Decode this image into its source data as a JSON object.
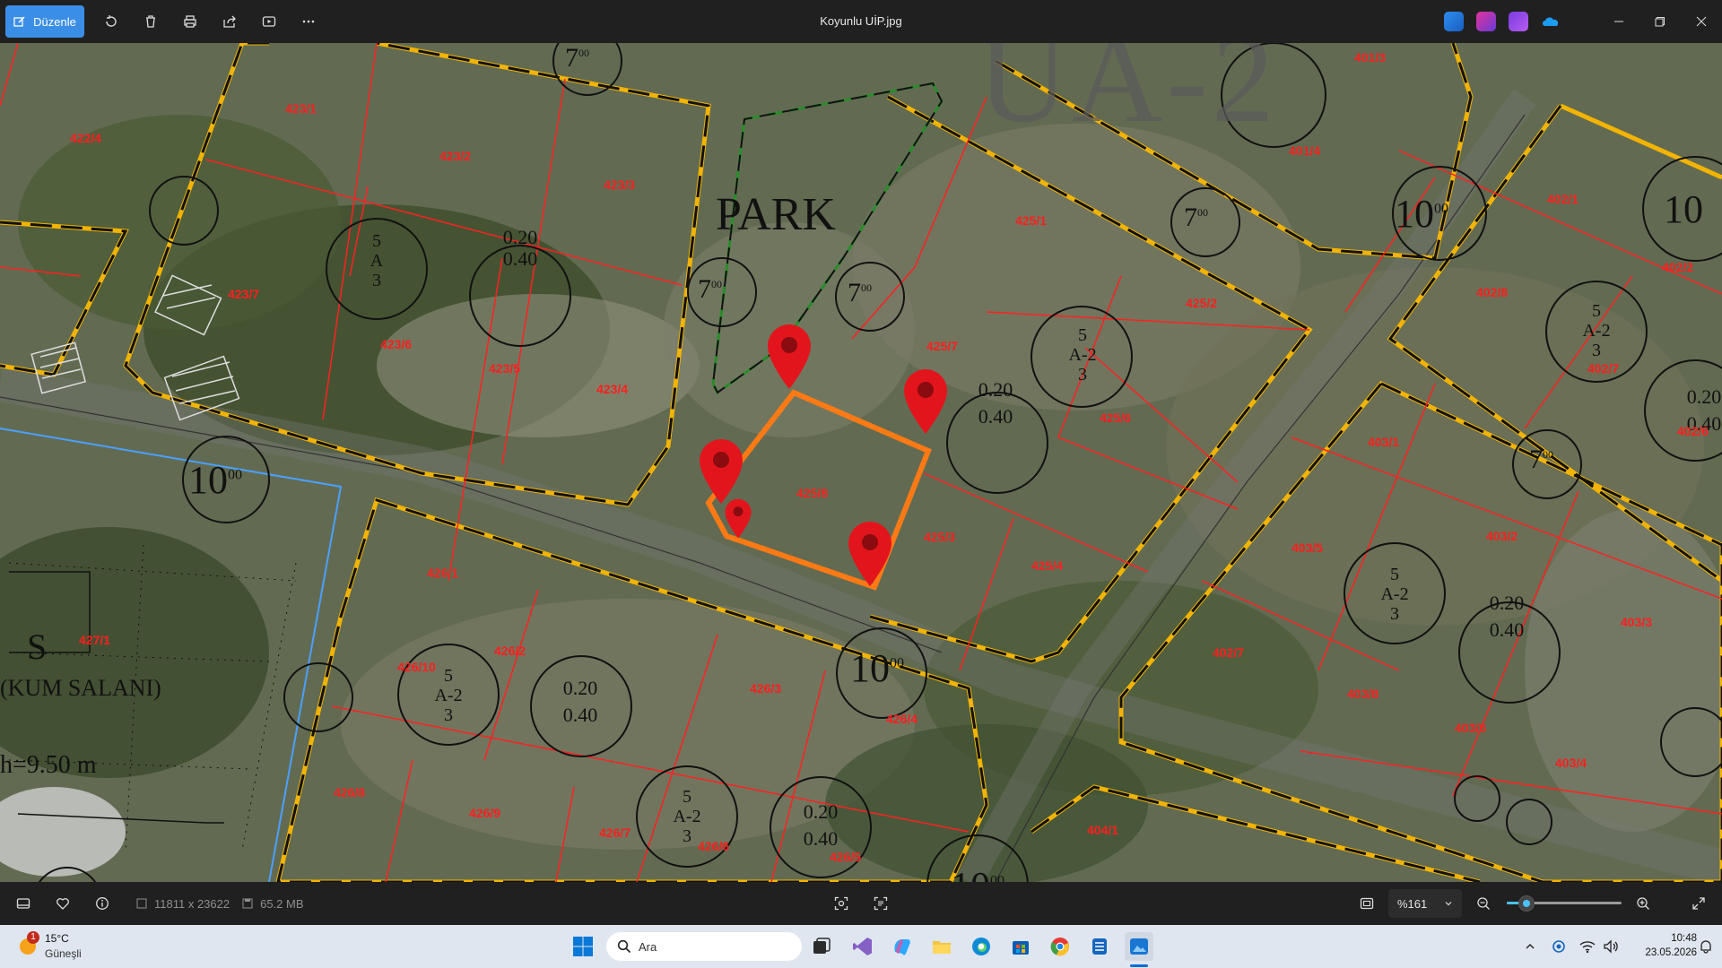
{
  "toolbar": {
    "edit_label": "Düzenle",
    "file_title": "Koyunlu UİP.jpg"
  },
  "map": {
    "park_label": "PARK",
    "zone_label": "UA-2",
    "parcels": [
      "423/1",
      "423/2",
      "423/3",
      "422/4",
      "423/7",
      "423/6",
      "423/5",
      "423/4",
      "425/1",
      "425/2",
      "425/7",
      "425/8",
      "425/3",
      "425/6",
      "425/4",
      "401/3",
      "401/4",
      "402/1",
      "402/2",
      "402/8",
      "402/7",
      "402/6",
      "403/1",
      "403/5",
      "403/2",
      "403/3",
      "402/7",
      "403/8",
      "403/6",
      "403/4",
      "426/1",
      "426/2",
      "426/10",
      "426/3",
      "426/4",
      "426/8",
      "426/9",
      "426/7",
      "426/6",
      "426/5",
      "427/1",
      "404/1"
    ],
    "density_top": "0.20",
    "density_bottom": "0.40",
    "road_10": "10",
    "road_7": "7",
    "sup": "00",
    "zone_A": "A",
    "zone_5": "5",
    "zone_2": "2",
    "zone_3": "3",
    "left_letter": "S",
    "left_text": "(KUM SALANI)",
    "left_height": "h=9.50 m",
    "marker_count": 5
  },
  "status": {
    "dimensions": "11811 x 23622",
    "size": "65.2 MB",
    "zoom": "%161",
    "zoom_level": 0.17
  },
  "taskbar": {
    "weather_temp": "15°C",
    "weather_desc": "Güneşli",
    "weather_badge": "1",
    "search_placeholder": "Ara",
    "time": "10:48",
    "date": "23.05.2026"
  }
}
